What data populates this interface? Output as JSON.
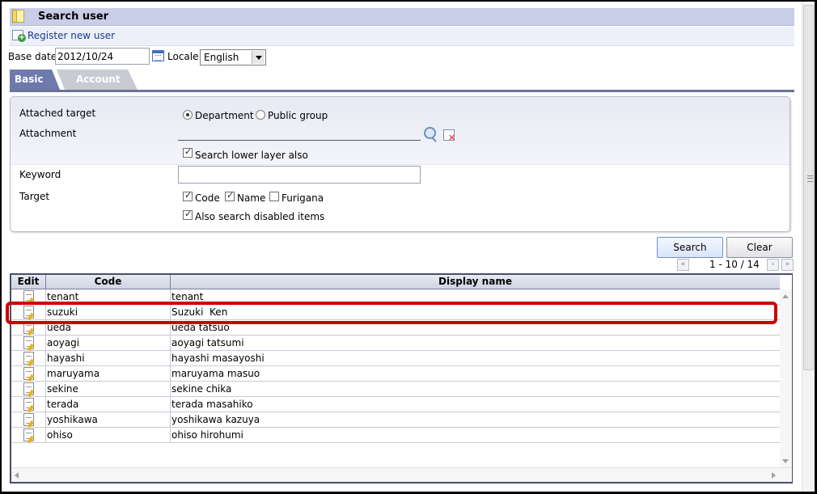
{
  "header": {
    "title": "Search user",
    "register_link": "Register new user"
  },
  "filters": {
    "base_date_label": "Base date",
    "base_date_value": "2012/10/24",
    "locale_label": "Locale",
    "locale_value": "English"
  },
  "tabs": [
    {
      "label": "Basic"
    },
    {
      "label": "Account"
    }
  ],
  "form": {
    "attached_target_label": "Attached target",
    "radio_department": "Department",
    "radio_public_group": "Public group",
    "attachment_label": "Attachment",
    "search_lower_layer": "Search lower layer also",
    "keyword_label": "Keyword",
    "target_label": "Target",
    "target_code": "Code",
    "target_name": "Name",
    "target_furigana": "Furigana",
    "also_disabled": "Also search disabled items"
  },
  "buttons": {
    "search": "Search",
    "clear": "Clear"
  },
  "pager": {
    "text": "1 - 10 / 14",
    "prev": "«",
    "next": "›",
    "last": "»"
  },
  "grid": {
    "columns": [
      "Edit",
      "Code",
      "Display name"
    ],
    "rows": [
      {
        "code": "tenant",
        "name": "tenant"
      },
      {
        "code": "suzuki",
        "name": "Suzuki  Ken"
      },
      {
        "code": "ueda",
        "name": "ueda tatsuo"
      },
      {
        "code": "aoyagi",
        "name": "aoyagi tatsumi"
      },
      {
        "code": "hayashi",
        "name": "hayashi masayoshi"
      },
      {
        "code": "maruyama",
        "name": "maruyama masuo"
      },
      {
        "code": "sekine",
        "name": "sekine chika"
      },
      {
        "code": "terada",
        "name": "terada masahiko"
      },
      {
        "code": "yoshikawa",
        "name": "yoshikawa kazuya"
      },
      {
        "code": "ohiso",
        "name": "ohiso hirohumi"
      }
    ]
  },
  "colors": {
    "highlight": "#cc0000",
    "tab_active": "#6e7aab",
    "title_bar": "#c8cde8"
  }
}
